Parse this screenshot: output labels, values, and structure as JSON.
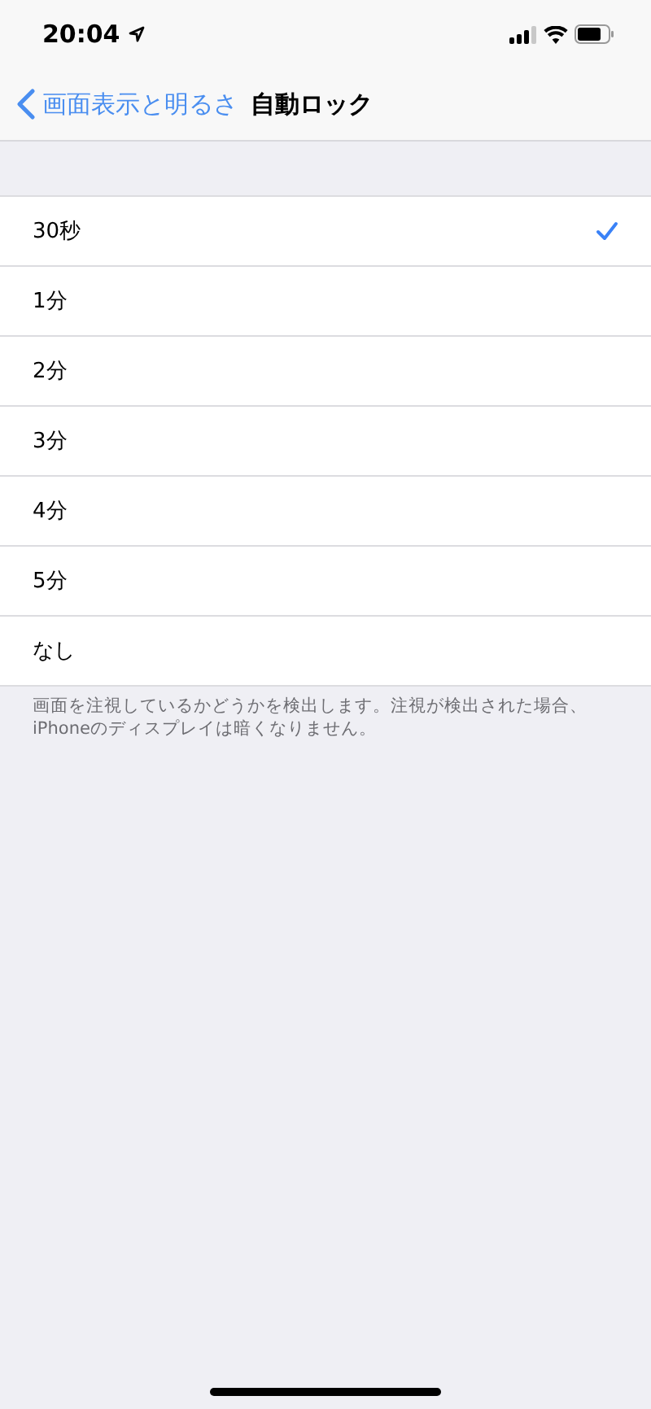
{
  "status_bar": {
    "time": "20:04"
  },
  "nav": {
    "back": "画面表示と明るさ",
    "title": "自動ロック"
  },
  "options": [
    {
      "label": "30秒",
      "selected": true
    },
    {
      "label": "1分",
      "selected": false
    },
    {
      "label": "2分",
      "selected": false
    },
    {
      "label": "3分",
      "selected": false
    },
    {
      "label": "4分",
      "selected": false
    },
    {
      "label": "5分",
      "selected": false
    },
    {
      "label": "なし",
      "selected": false
    }
  ],
  "footer": "画面を注視しているかどうかを検出します。注視が検出された場合、iPhoneのディスプレイは暗くなりません。"
}
